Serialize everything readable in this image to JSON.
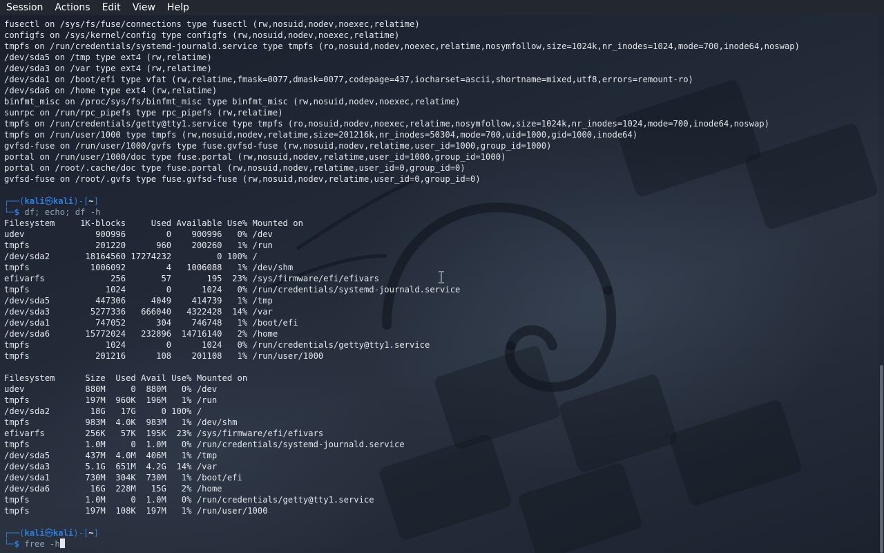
{
  "menubar": {
    "items": [
      "Session",
      "Actions",
      "Edit",
      "View",
      "Help"
    ]
  },
  "terminal": {
    "mount_lines": [
      "fusectl on /sys/fs/fuse/connections type fusectl (rw,nosuid,nodev,noexec,relatime)",
      "configfs on /sys/kernel/config type configfs (rw,nosuid,nodev,noexec,relatime)",
      "tmpfs on /run/credentials/systemd-journald.service type tmpfs (ro,nosuid,nodev,noexec,relatime,nosymfollow,size=1024k,nr_inodes=1024,mode=700,inode64,noswap)",
      "/dev/sda5 on /tmp type ext4 (rw,relatime)",
      "/dev/sda3 on /var type ext4 (rw,relatime)",
      "/dev/sda1 on /boot/efi type vfat (rw,relatime,fmask=0077,dmask=0077,codepage=437,iocharset=ascii,shortname=mixed,utf8,errors=remount-ro)",
      "/dev/sda6 on /home type ext4 (rw,relatime)",
      "binfmt_misc on /proc/sys/fs/binfmt_misc type binfmt_misc (rw,nosuid,nodev,noexec,relatime)",
      "sunrpc on /run/rpc_pipefs type rpc_pipefs (rw,relatime)",
      "tmpfs on /run/credentials/getty@tty1.service type tmpfs (ro,nosuid,nodev,noexec,relatime,nosymfollow,size=1024k,nr_inodes=1024,mode=700,inode64,noswap)",
      "tmpfs on /run/user/1000 type tmpfs (rw,nosuid,nodev,relatime,size=201216k,nr_inodes=50304,mode=700,uid=1000,gid=1000,inode64)",
      "gvfsd-fuse on /run/user/1000/gvfs type fuse.gvfsd-fuse (rw,nosuid,nodev,relatime,user_id=1000,group_id=1000)",
      "portal on /run/user/1000/doc type fuse.portal (rw,nosuid,nodev,relatime,user_id=1000,group_id=1000)",
      "portal on /root/.cache/doc type fuse.portal (rw,nosuid,nodev,relatime,user_id=0,group_id=0)",
      "gvfsd-fuse on /root/.gvfs type fuse.gvfsd-fuse (rw,nosuid,nodev,relatime,user_id=0,group_id=0)"
    ],
    "prompt": {
      "frame_top_left": "┌──(",
      "user": "kali",
      "at_symbol": "㉿",
      "host": "kali",
      "frame_mid": ")-[",
      "path": "~",
      "frame_end": "]",
      "frame_bottom": "└─",
      "dollar": "$ "
    },
    "command_1": "df; echo; df -h",
    "df_header": "Filesystem     1K-blocks     Used Available Use% Mounted on",
    "df_rows": [
      "udev              900996        0    900996   0% /dev",
      "tmpfs             201220      960    200260   1% /run",
      "/dev/sda2       18164560 17274232         0 100% /",
      "tmpfs            1006092        4   1006088   1% /dev/shm",
      "efivarfs             256       57       195  23% /sys/firmware/efi/efivars",
      "tmpfs               1024        0      1024   0% /run/credentials/systemd-journald.service",
      "/dev/sda5         447306     4049    414739   1% /tmp",
      "/dev/sda3        5277336   666040   4322428  14% /var",
      "/dev/sda1         747052      304    746748   1% /boot/efi",
      "/dev/sda6       15772024   232896  14716140   2% /home",
      "tmpfs               1024        0      1024   0% /run/credentials/getty@tty1.service",
      "tmpfs             201216      108    201108   1% /run/user/1000"
    ],
    "dfh_header": "Filesystem      Size  Used Avail Use% Mounted on",
    "dfh_rows": [
      "udev            880M     0  880M   0% /dev",
      "tmpfs           197M  960K  196M   1% /run",
      "/dev/sda2        18G   17G     0 100% /",
      "tmpfs           983M  4.0K  983M   1% /dev/shm",
      "efivarfs        256K   57K  195K  23% /sys/firmware/efi/efivars",
      "tmpfs           1.0M     0  1.0M   0% /run/credentials/systemd-journald.service",
      "/dev/sda5       437M  4.0M  406M   1% /tmp",
      "/dev/sda3       5.1G  651M  4.2G  14% /var",
      "/dev/sda1       730M  304K  730M   1% /boot/efi",
      "/dev/sda6        16G  228M   15G   2% /home",
      "tmpfs           1.0M     0  1.0M   0% /run/credentials/getty@tty1.service",
      "tmpfs           197M  108K  197M   1% /run/user/1000"
    ],
    "command_2": "free -h",
    "colors": {
      "prompt_blue": "#2f7ddc",
      "text": "#e4e6ea",
      "command_grey": "#8fa2b8",
      "menubar_bg": "#232830"
    }
  }
}
